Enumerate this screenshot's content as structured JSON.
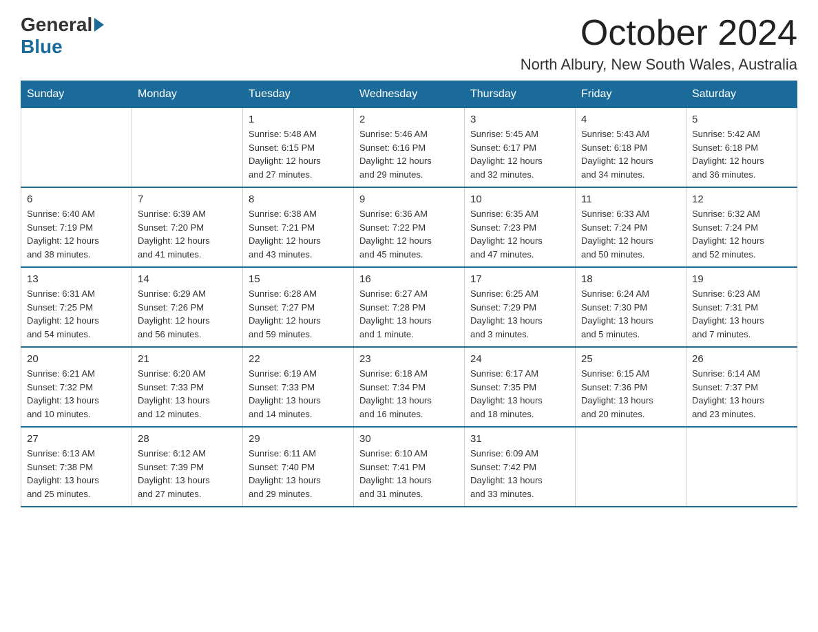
{
  "logo": {
    "general": "General",
    "blue": "Blue"
  },
  "header": {
    "month": "October 2024",
    "location": "North Albury, New South Wales, Australia"
  },
  "weekdays": [
    "Sunday",
    "Monday",
    "Tuesday",
    "Wednesday",
    "Thursday",
    "Friday",
    "Saturday"
  ],
  "weeks": [
    [
      {
        "day": "",
        "info": ""
      },
      {
        "day": "",
        "info": ""
      },
      {
        "day": "1",
        "info": "Sunrise: 5:48 AM\nSunset: 6:15 PM\nDaylight: 12 hours\nand 27 minutes."
      },
      {
        "day": "2",
        "info": "Sunrise: 5:46 AM\nSunset: 6:16 PM\nDaylight: 12 hours\nand 29 minutes."
      },
      {
        "day": "3",
        "info": "Sunrise: 5:45 AM\nSunset: 6:17 PM\nDaylight: 12 hours\nand 32 minutes."
      },
      {
        "day": "4",
        "info": "Sunrise: 5:43 AM\nSunset: 6:18 PM\nDaylight: 12 hours\nand 34 minutes."
      },
      {
        "day": "5",
        "info": "Sunrise: 5:42 AM\nSunset: 6:18 PM\nDaylight: 12 hours\nand 36 minutes."
      }
    ],
    [
      {
        "day": "6",
        "info": "Sunrise: 6:40 AM\nSunset: 7:19 PM\nDaylight: 12 hours\nand 38 minutes."
      },
      {
        "day": "7",
        "info": "Sunrise: 6:39 AM\nSunset: 7:20 PM\nDaylight: 12 hours\nand 41 minutes."
      },
      {
        "day": "8",
        "info": "Sunrise: 6:38 AM\nSunset: 7:21 PM\nDaylight: 12 hours\nand 43 minutes."
      },
      {
        "day": "9",
        "info": "Sunrise: 6:36 AM\nSunset: 7:22 PM\nDaylight: 12 hours\nand 45 minutes."
      },
      {
        "day": "10",
        "info": "Sunrise: 6:35 AM\nSunset: 7:23 PM\nDaylight: 12 hours\nand 47 minutes."
      },
      {
        "day": "11",
        "info": "Sunrise: 6:33 AM\nSunset: 7:24 PM\nDaylight: 12 hours\nand 50 minutes."
      },
      {
        "day": "12",
        "info": "Sunrise: 6:32 AM\nSunset: 7:24 PM\nDaylight: 12 hours\nand 52 minutes."
      }
    ],
    [
      {
        "day": "13",
        "info": "Sunrise: 6:31 AM\nSunset: 7:25 PM\nDaylight: 12 hours\nand 54 minutes."
      },
      {
        "day": "14",
        "info": "Sunrise: 6:29 AM\nSunset: 7:26 PM\nDaylight: 12 hours\nand 56 minutes."
      },
      {
        "day": "15",
        "info": "Sunrise: 6:28 AM\nSunset: 7:27 PM\nDaylight: 12 hours\nand 59 minutes."
      },
      {
        "day": "16",
        "info": "Sunrise: 6:27 AM\nSunset: 7:28 PM\nDaylight: 13 hours\nand 1 minute."
      },
      {
        "day": "17",
        "info": "Sunrise: 6:25 AM\nSunset: 7:29 PM\nDaylight: 13 hours\nand 3 minutes."
      },
      {
        "day": "18",
        "info": "Sunrise: 6:24 AM\nSunset: 7:30 PM\nDaylight: 13 hours\nand 5 minutes."
      },
      {
        "day": "19",
        "info": "Sunrise: 6:23 AM\nSunset: 7:31 PM\nDaylight: 13 hours\nand 7 minutes."
      }
    ],
    [
      {
        "day": "20",
        "info": "Sunrise: 6:21 AM\nSunset: 7:32 PM\nDaylight: 13 hours\nand 10 minutes."
      },
      {
        "day": "21",
        "info": "Sunrise: 6:20 AM\nSunset: 7:33 PM\nDaylight: 13 hours\nand 12 minutes."
      },
      {
        "day": "22",
        "info": "Sunrise: 6:19 AM\nSunset: 7:33 PM\nDaylight: 13 hours\nand 14 minutes."
      },
      {
        "day": "23",
        "info": "Sunrise: 6:18 AM\nSunset: 7:34 PM\nDaylight: 13 hours\nand 16 minutes."
      },
      {
        "day": "24",
        "info": "Sunrise: 6:17 AM\nSunset: 7:35 PM\nDaylight: 13 hours\nand 18 minutes."
      },
      {
        "day": "25",
        "info": "Sunrise: 6:15 AM\nSunset: 7:36 PM\nDaylight: 13 hours\nand 20 minutes."
      },
      {
        "day": "26",
        "info": "Sunrise: 6:14 AM\nSunset: 7:37 PM\nDaylight: 13 hours\nand 23 minutes."
      }
    ],
    [
      {
        "day": "27",
        "info": "Sunrise: 6:13 AM\nSunset: 7:38 PM\nDaylight: 13 hours\nand 25 minutes."
      },
      {
        "day": "28",
        "info": "Sunrise: 6:12 AM\nSunset: 7:39 PM\nDaylight: 13 hours\nand 27 minutes."
      },
      {
        "day": "29",
        "info": "Sunrise: 6:11 AM\nSunset: 7:40 PM\nDaylight: 13 hours\nand 29 minutes."
      },
      {
        "day": "30",
        "info": "Sunrise: 6:10 AM\nSunset: 7:41 PM\nDaylight: 13 hours\nand 31 minutes."
      },
      {
        "day": "31",
        "info": "Sunrise: 6:09 AM\nSunset: 7:42 PM\nDaylight: 13 hours\nand 33 minutes."
      },
      {
        "day": "",
        "info": ""
      },
      {
        "day": "",
        "info": ""
      }
    ]
  ]
}
